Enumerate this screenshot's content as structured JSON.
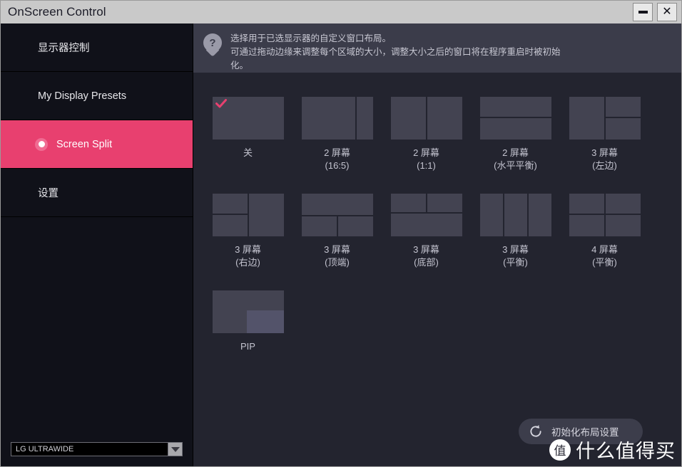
{
  "window": {
    "title": "OnScreen Control",
    "minimize_label": "–",
    "close_label": "✕"
  },
  "sidebar": {
    "items": [
      {
        "label": "显示器控制",
        "active": false
      },
      {
        "label": "My Display Presets",
        "active": false
      },
      {
        "label": "Screen Split",
        "active": true
      },
      {
        "label": "设置",
        "active": false
      }
    ],
    "monitor_select": {
      "value": "LG ULTRAWIDE",
      "arrow": "chevron-down-icon"
    }
  },
  "help": {
    "icon": "question-mark-pin-icon",
    "line1": "选择用于已选显示器的自定义窗口布局。",
    "line2": "可通过拖动边缘来调整每个区域的大小，调整大小之后的窗口将在程序重启时被初始",
    "line3": "化。"
  },
  "layouts": {
    "selected_index": 0,
    "tiles": [
      {
        "name": "off",
        "label_line1": "关",
        "label_line2": "",
        "selected": true
      },
      {
        "name": "2-screen-16-5",
        "label_line1": "2 屏幕",
        "label_line2": "(16:5)",
        "selected": false
      },
      {
        "name": "2-screen-1-1",
        "label_line1": "2 屏幕",
        "label_line2": "(1:1)",
        "selected": false
      },
      {
        "name": "2-screen-horizontal-balanced",
        "label_line1": "2 屏幕",
        "label_line2": "(水平平衡)",
        "selected": false
      },
      {
        "name": "3-screen-left",
        "label_line1": "3 屏幕",
        "label_line2": "(左边)",
        "selected": false
      },
      {
        "name": "3-screen-right",
        "label_line1": "3 屏幕",
        "label_line2": "(右边)",
        "selected": false
      },
      {
        "name": "3-screen-top",
        "label_line1": "3 屏幕",
        "label_line2": "(顶端)",
        "selected": false
      },
      {
        "name": "3-screen-bottom",
        "label_line1": "3 屏幕",
        "label_line2": "(底部)",
        "selected": false
      },
      {
        "name": "3-screen-balanced",
        "label_line1": "3 屏幕",
        "label_line2": "(平衡)",
        "selected": false
      },
      {
        "name": "4-screen-balanced",
        "label_line1": "4 屏幕",
        "label_line2": "(平衡)",
        "selected": false
      },
      {
        "name": "pip",
        "label_line1": "PIP",
        "label_line2": "",
        "selected": false
      }
    ]
  },
  "reset_button": {
    "label": "初始化布局设置",
    "icon": "refresh-icon"
  },
  "watermark": {
    "logo": "值",
    "text": "什么值得买"
  },
  "colors": {
    "accent": "#e8406f",
    "sidebar_bg": "#101119",
    "main_bg": "#23242f",
    "pane": "#434351",
    "help_bg": "#3b3c4a",
    "titlebar": "#c9c9c9"
  }
}
